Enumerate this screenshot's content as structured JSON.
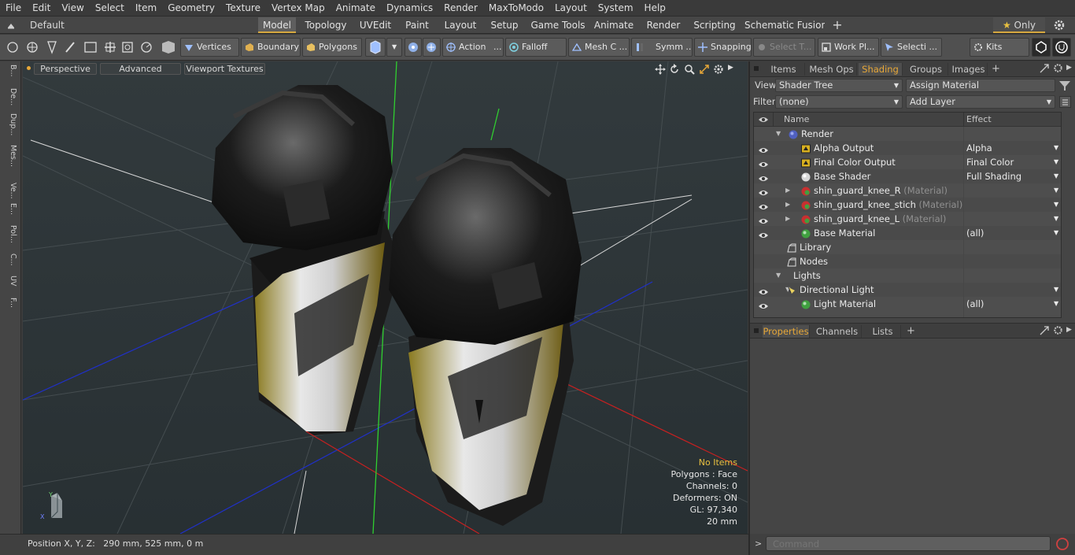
{
  "menu": [
    "File",
    "Edit",
    "View",
    "Select",
    "Item",
    "Geometry",
    "Texture",
    "Vertex Map",
    "Animate",
    "Dynamics",
    "Render",
    "MaxToModo",
    "Layout",
    "System",
    "Help"
  ],
  "layout_bar": {
    "preset": "Default Layouts",
    "tabs": [
      "Model",
      "Topology",
      "UVEdit",
      "Paint",
      "Layout",
      "Setup",
      "Game Tools",
      "Animate",
      "Render",
      "Scripting",
      "Schematic Fusion"
    ],
    "active_tab": "Model",
    "plus": "+",
    "only_label": "Only"
  },
  "toolbar": {
    "vertices": "Vertices",
    "boundary": "Boundary",
    "polygons": "Polygons",
    "action": "Action",
    "action_more": "...",
    "falloff": "Falloff",
    "mesh": "Mesh C ...",
    "symm": "Symm ...",
    "snapping": "Snapping",
    "select_t": "Select T...",
    "workplane": "Work Pl...",
    "selecti": "Selecti ...",
    "kits": "Kits"
  },
  "left_tabs": [
    "B...",
    "De...",
    "Dup...",
    "Mes...",
    "Ve...",
    "E...",
    "Pol...",
    "C...",
    "UV",
    "F..."
  ],
  "viewport": {
    "view_mode": "Perspective",
    "advanced": "Advanced",
    "textures": "Viewport Textures",
    "info": {
      "no_items": "No Items",
      "polygons": "Polygons : Face",
      "channels": "Channels: 0",
      "deformers": "Deformers: ON",
      "gl": "GL: 97,340",
      "scale": "20 mm"
    },
    "axis_y": "Y",
    "axis_x": "X"
  },
  "status": {
    "position": "Position X, Y, Z:   290 mm, 525 mm, 0 m"
  },
  "panel": {
    "tabs": [
      "Items",
      "Mesh Ops",
      "Shading",
      "Groups",
      "Images"
    ],
    "active_tab": "Shading",
    "plus": "+",
    "view_label": "View",
    "view_value": "Shader Tree",
    "assign_material": "Assign Material",
    "filter_label": "Filter",
    "filter_value": "(none)",
    "add_layer": "Add Layer",
    "col_name": "Name",
    "col_effect": "Effect",
    "rows": [
      {
        "name": "Render",
        "sub": "",
        "effect": "",
        "eye": false,
        "icon": "render",
        "ind": 0,
        "tri": "open"
      },
      {
        "name": "Alpha Output",
        "sub": "",
        "effect": "Alpha",
        "eye": true,
        "icon": "output",
        "ind": 2,
        "tri": ""
      },
      {
        "name": "Final Color Output",
        "sub": "",
        "effect": "Final Color",
        "eye": true,
        "icon": "output",
        "ind": 2,
        "tri": ""
      },
      {
        "name": "Base Shader",
        "sub": "",
        "effect": "Full Shading",
        "eye": true,
        "icon": "shader",
        "ind": 2,
        "tri": ""
      },
      {
        "name": "shin_guard_knee_R",
        "sub": " (Material)",
        "effect": "",
        "eye": true,
        "icon": "mat",
        "ind": 2,
        "tri": "closed"
      },
      {
        "name": "shin_guard_knee_stich",
        "sub": " (Material)",
        "effect": "",
        "eye": true,
        "icon": "mat",
        "ind": 2,
        "tri": "closed"
      },
      {
        "name": "shin_guard_knee_L",
        "sub": " (Material)",
        "effect": "",
        "eye": true,
        "icon": "mat",
        "ind": 2,
        "tri": "closed"
      },
      {
        "name": "Base Material",
        "sub": "",
        "effect": "(all)",
        "eye": true,
        "icon": "basemat",
        "ind": 2,
        "tri": ""
      },
      {
        "name": "Library",
        "sub": "",
        "effect": "",
        "eye": false,
        "icon": "folder",
        "ind": 1,
        "tri": ""
      },
      {
        "name": "Nodes",
        "sub": "",
        "effect": "",
        "eye": false,
        "icon": "folder",
        "ind": 1,
        "tri": ""
      },
      {
        "name": "Lights",
        "sub": "",
        "effect": "",
        "eye": false,
        "icon": "none",
        "ind": 0,
        "tri": "open"
      },
      {
        "name": "Directional Light",
        "sub": "",
        "effect": "",
        "eye": true,
        "icon": "light",
        "ind": 1,
        "tri": "open"
      },
      {
        "name": "Light Material",
        "sub": "",
        "effect": "(all)",
        "eye": true,
        "icon": "basemat",
        "ind": 2,
        "tri": ""
      }
    ],
    "lower_tabs": [
      "Properties",
      "Channels",
      "Lists"
    ],
    "lower_active": "Properties",
    "command_placeholder": "Command",
    "cmd_prompt": ">"
  },
  "colors": {
    "accent": "#e8a838",
    "viewport_bg": "#2d3335",
    "panel_bg": "#454545"
  }
}
